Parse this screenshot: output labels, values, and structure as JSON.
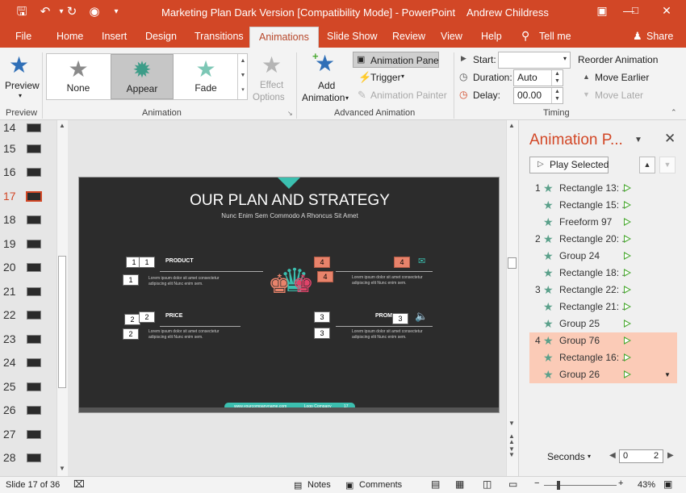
{
  "titlebar": {
    "title": "Marketing Plan Dark Version [Compatibility Mode]  -  PowerPoint",
    "user": "Andrew Childress",
    "save_icon": "save-icon",
    "undo_icon": "undo-icon",
    "redo_icon": "redo-icon",
    "custom_icon": "start-from-beginning-icon",
    "customize_icon": "customize-qat-icon"
  },
  "tabs": [
    "File",
    "Home",
    "Insert",
    "Design",
    "Transitions",
    "Animations",
    "Slide Show",
    "Review",
    "View",
    "Help"
  ],
  "active_tab": "Animations",
  "tell_me": "Tell me",
  "share": "Share",
  "ribbon": {
    "preview": {
      "label": "Preview",
      "group": "Preview"
    },
    "animation_group": "Animation",
    "gallery": [
      {
        "label": "None",
        "color": "#8a8a8a"
      },
      {
        "label": "Appear",
        "color": "#3d9c88"
      },
      {
        "label": "Fade",
        "color": "#7cc7b5"
      }
    ],
    "effect_options": [
      "Effect",
      "Options"
    ],
    "advanced": {
      "add_animation": [
        "Add",
        "Animation"
      ],
      "animation_pane": "Animation Pane",
      "trigger": "Trigger",
      "animation_painter": "Animation Painter",
      "group": "Advanced Animation"
    },
    "timing": {
      "start_label": "Start:",
      "start_value": "",
      "duration_label": "Duration:",
      "duration_value": "Auto",
      "delay_label": "Delay:",
      "delay_value": "00.00",
      "reorder": "Reorder Animation",
      "move_earlier": "Move Earlier",
      "move_later": "Move Later",
      "group": "Timing"
    }
  },
  "thumbnails": [
    "14",
    "15",
    "16",
    "17",
    "18",
    "19",
    "20",
    "21",
    "22",
    "23",
    "24",
    "25",
    "26",
    "27",
    "28"
  ],
  "selected_slide": "17",
  "slide": {
    "title_light": "OUR PLAN",
    "title_bold": "AND STRATEGY",
    "subtitle": "Nunc Enim Sem Commodo A Rhoncus Sit Amet",
    "left_top_heading": "PRODUCT",
    "left_bottom_heading": "PRICE",
    "right_bottom_heading": "PROM",
    "body": "Lorem ipsum dolor sit amet consectetur adipiscing elit Nunc enim sem.",
    "footer_url": "www.yourcompanyname.com",
    "footer_company": "Logo Company",
    "footer_page": "17",
    "tags": {
      "one": "1",
      "two": "2",
      "three": "3",
      "four": "4"
    }
  },
  "pane": {
    "title": "Animation P...",
    "play_selected": "Play Selected",
    "items": [
      {
        "num": "1",
        "name": "Rectangle 13: ...",
        "hl": false
      },
      {
        "num": "",
        "name": "Rectangle 15: ...",
        "hl": false
      },
      {
        "num": "",
        "name": "Freeform 97",
        "hl": false
      },
      {
        "num": "2",
        "name": "Rectangle 20: ...",
        "hl": false
      },
      {
        "num": "",
        "name": "Group 24",
        "hl": false
      },
      {
        "num": "",
        "name": "Rectangle 18: ...",
        "hl": false
      },
      {
        "num": "3",
        "name": "Rectangle 22: ...",
        "hl": false
      },
      {
        "num": "",
        "name": "Rectangle 21: ...",
        "hl": false
      },
      {
        "num": "",
        "name": "Group 25",
        "hl": false
      },
      {
        "num": "4",
        "name": "Group 76",
        "hl": true
      },
      {
        "num": "",
        "name": "Rectangle 16: ...",
        "hl": true
      },
      {
        "num": "",
        "name": "Group 26",
        "hl": true
      }
    ],
    "seconds": "Seconds",
    "timeline_start": "0",
    "timeline_end": "2"
  },
  "status": {
    "slide_info": "Slide 17 of 36",
    "notes": "Notes",
    "comments": "Comments",
    "zoom": "43%"
  },
  "colors": {
    "accent": "#d24726",
    "highlight": "#fbcbb7",
    "play": "#4caa34"
  }
}
